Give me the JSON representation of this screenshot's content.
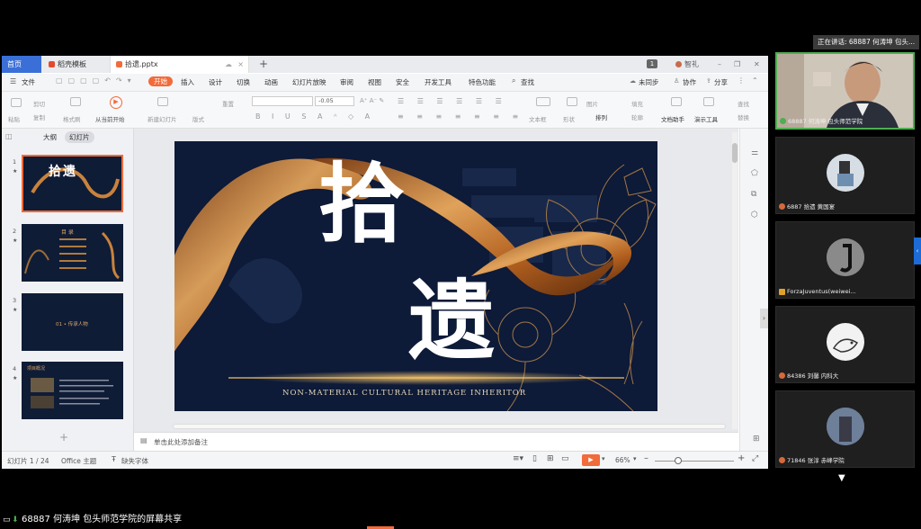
{
  "speaking_banner": "正在讲话: 68887 何涛坤 包头...",
  "share_caption": "68887 何涛坤 包头师范学院的屏幕共享",
  "app": {
    "tabs": [
      {
        "label": "首页"
      },
      {
        "label": "稻壳模板"
      },
      {
        "label": "拾遗.pptx"
      }
    ],
    "tab_count": "1",
    "user_label": "智礼",
    "ribbon_tabs": [
      "文件",
      "开始",
      "插入",
      "设计",
      "切换",
      "动画",
      "幻灯片放映",
      "审阅",
      "视图",
      "安全",
      "开发工具",
      "特色功能",
      "查找"
    ],
    "ribbon_right": [
      "未同步",
      "协作",
      "分享"
    ],
    "toolbar": {
      "paste": "粘贴",
      "cut": "剪切",
      "copy": "复制",
      "format_painter": "格式刷",
      "play_from_current": "从当前开始",
      "new_slide": "新建幻灯片",
      "layout": "版式",
      "reset": "重置",
      "font_size_value": "-0.05",
      "textbox": "文本框",
      "shape": "形状",
      "arrange": "排列",
      "image": "图片",
      "fill": "填充",
      "outline": "轮廓",
      "doc_assistant": "文档助手",
      "presentation_tools": "演示工具",
      "find": "查找",
      "replace": "替换"
    },
    "pane_tabs": [
      "大纲",
      "幻灯片"
    ],
    "thumbnails": [
      {
        "num": "1",
        "title": "拾遗"
      },
      {
        "num": "2",
        "title": "目 录"
      },
      {
        "num": "3",
        "title": "01 • 传承人物"
      },
      {
        "num": "4",
        "title": "项目概况"
      }
    ],
    "slide": {
      "title_char1": "拾",
      "title_char2": "遗",
      "subtitle": "NON-MATERIAL CULTURAL HERITAGE INHERITOR",
      "bg_calligraphy": "传承"
    },
    "notes_placeholder": "单击此处添加备注",
    "status": {
      "slide_info": "幻灯片 1 / 24",
      "theme": "Office 主题",
      "missing_font": "缺失字体",
      "zoom": "66%"
    }
  },
  "participants": [
    {
      "name": "68887 何涛坤 包头师范学院",
      "kind": "video"
    },
    {
      "name": "6887 拾遗 黄国宴",
      "kind": "avatar"
    },
    {
      "name": "ForzaJuventus(weiwei...",
      "kind": "avatar"
    },
    {
      "name": "84386 刘馨 内科大",
      "kind": "avatar"
    },
    {
      "name": "71846 张淳 赤峰学院",
      "kind": "avatar"
    }
  ],
  "colors": {
    "accent": "#f26b3a",
    "slide_bg": "#0d1a38",
    "gold": "#c9823c"
  }
}
